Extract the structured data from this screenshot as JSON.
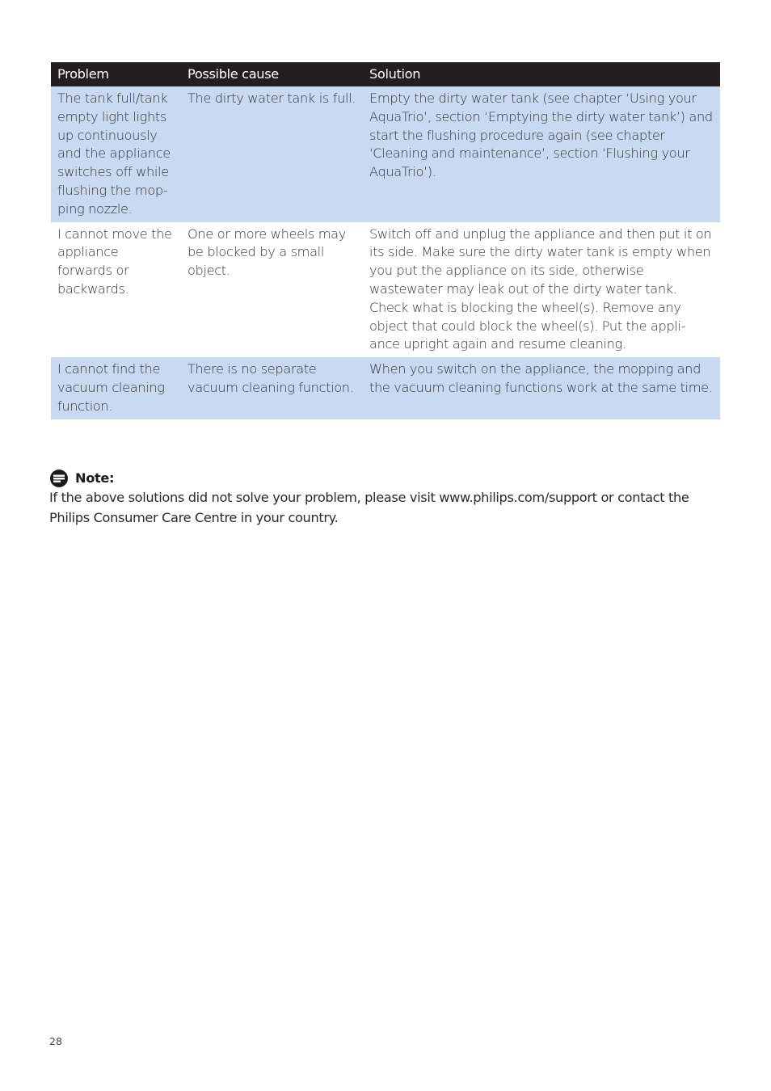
{
  "table": {
    "headers": [
      "Problem",
      "Possible cause",
      "Solution"
    ],
    "rows": [
      {
        "problem": "The tank full/tank empty light lights up continuously and the appliance switches off while flushing the mop-ping nozzle.",
        "cause": "The dirty water tank is full.",
        "solution": "Empty the dirty water tank (see chapter ‘Using your AquaTrio’, section ‘Emptying the dirty water tank’) and start the flushing procedure again (see chapter ‘Cleaning and maintenance’, section ‘Flushing your AquaTrio’)."
      },
      {
        "problem": "I cannot move the appliance forwards or backwards.",
        "cause": "One or more wheels may be blocked by a small object.",
        "solution": "Switch off and unplug the appliance and then put it on its side. Make sure the dirty water tank is empty when you put the appliance on its side, otherwise wastewater may leak out of the dirty water tank. Check what is blocking the wheel(s). Remove any object that could block the wheel(s). Put the appli-ance upright again and resume cleaning."
      },
      {
        "problem": "I cannot find the vacuum cleaning function.",
        "cause": "There is no separate vacuum cleaning function.",
        "solution": "When you switch on the appliance, the mopping and the vacuum cleaning functions work at the same time."
      }
    ]
  },
  "note": {
    "icon": "note-icon",
    "title": "Note:",
    "text": "If the above solutions did not solve your problem, please visit www.philips.com/support or contact the Philips Consumer Care Centre in your country."
  },
  "page_number": "28",
  "colors": {
    "header_bg": "#231f20",
    "row_shade": "#c9d9f2"
  }
}
